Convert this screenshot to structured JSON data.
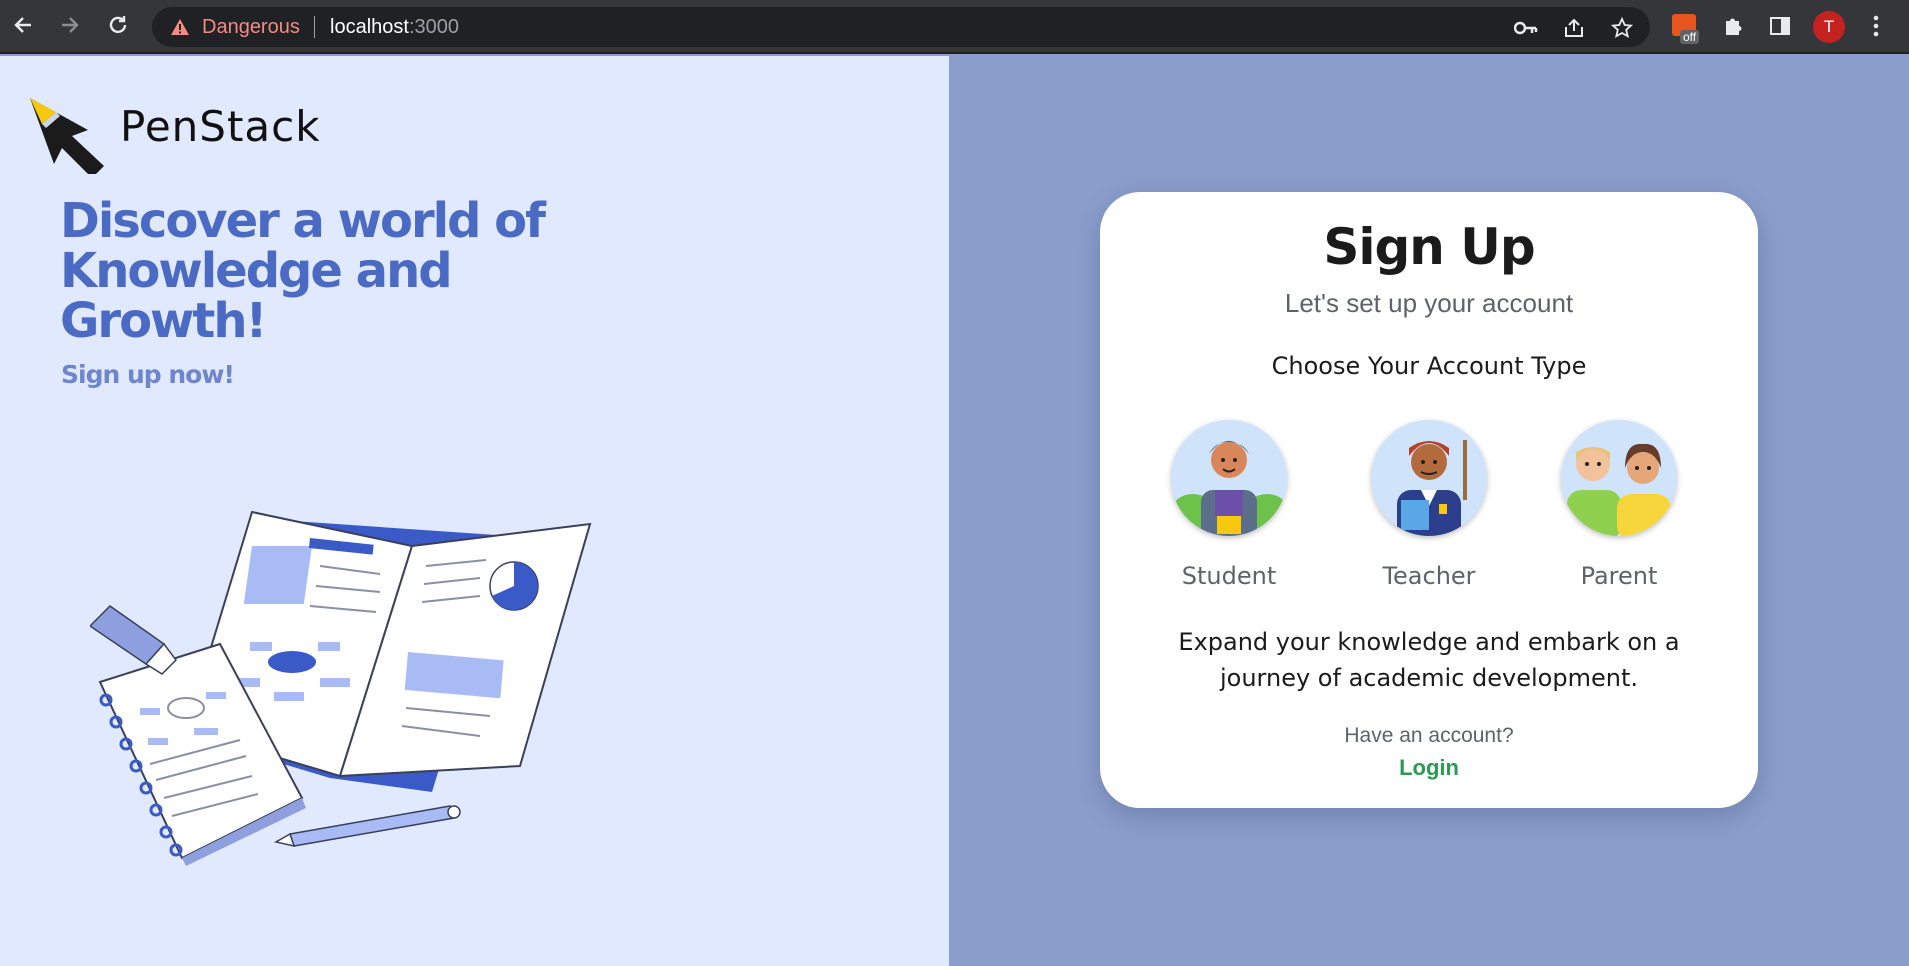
{
  "browser": {
    "security_label": "Dangerous",
    "url_host": "localhost",
    "url_port": ":3000",
    "profile_initial": "T",
    "extension_badge": "off"
  },
  "hero": {
    "brand": "PenStack",
    "headline": "Discover a world of Knowledge and Growth!",
    "cta": "Sign up now!"
  },
  "signup": {
    "title": "Sign Up",
    "subtitle": "Let's set up your account",
    "choose_label": "Choose Your Account Type",
    "account_types": [
      {
        "label": "Student"
      },
      {
        "label": "Teacher"
      },
      {
        "label": "Parent"
      }
    ],
    "description": "Expand your knowledge and embark on a journey of academic development.",
    "have_account": "Have an account?",
    "login_link": "Login"
  },
  "colors": {
    "left_bg": "#e1e9fe",
    "right_bg": "#8a9dcb",
    "accent": "#4b6ac4",
    "login_green": "#2c9a52"
  }
}
